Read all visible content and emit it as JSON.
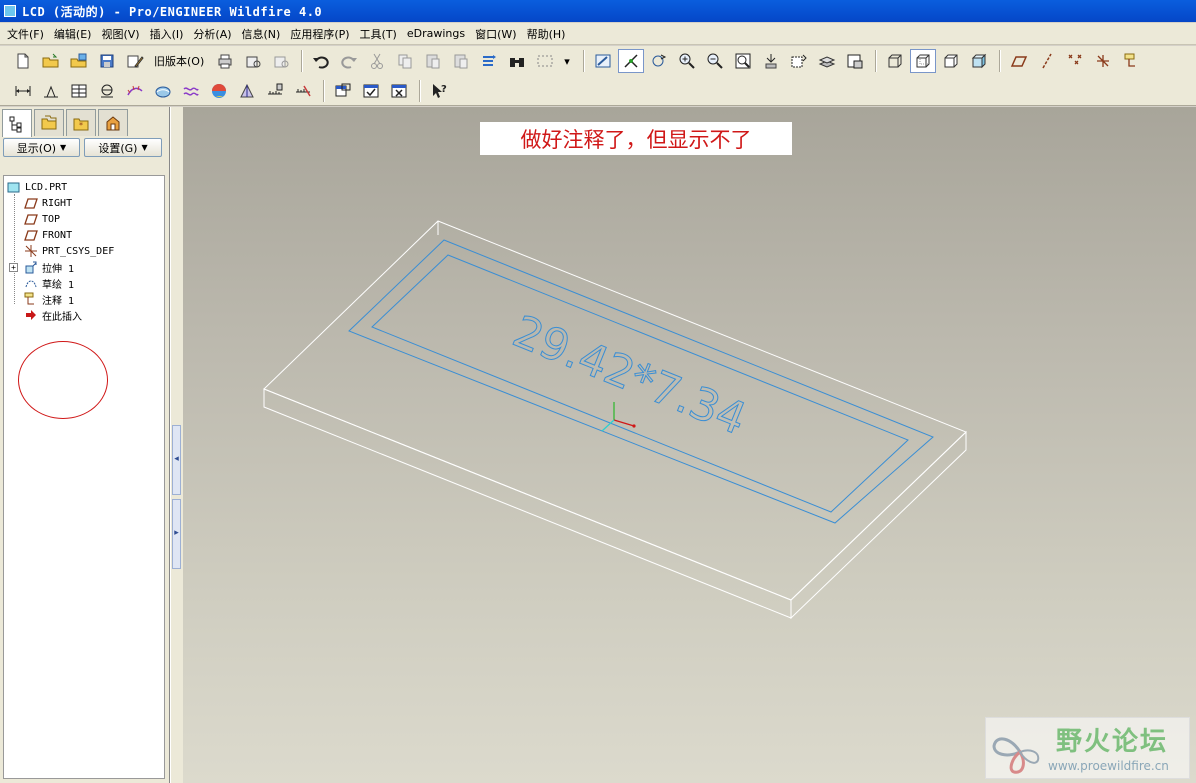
{
  "window": {
    "title": "LCD (活动的) - Pro/ENGINEER Wildfire 4.0"
  },
  "menu": [
    "文件(F)",
    "编辑(E)",
    "视图(V)",
    "插入(I)",
    "分析(A)",
    "信息(N)",
    "应用程序(P)",
    "工具(T)",
    "eDrawings",
    "窗口(W)",
    "帮助(H)"
  ],
  "toolbar": {
    "old_version_label": "旧版本(O)"
  },
  "panel": {
    "show_label": "显示(O)",
    "settings_label": "设置(G)",
    "tree": [
      {
        "label": "LCD.PRT",
        "icon": "part-icon"
      },
      {
        "label": "RIGHT",
        "icon": "datum-plane-icon"
      },
      {
        "label": "TOP",
        "icon": "datum-plane-icon"
      },
      {
        "label": "FRONT",
        "icon": "datum-plane-icon"
      },
      {
        "label": "PRT_CSYS_DEF",
        "icon": "coordinate-system-icon"
      },
      {
        "label": "拉伸 1",
        "icon": "extrude-icon"
      },
      {
        "label": "草绘 1",
        "icon": "sketch-icon"
      },
      {
        "label": "注释 1",
        "icon": "note-icon"
      },
      {
        "label": "在此插入",
        "icon": "insert-here-arrow-icon"
      }
    ]
  },
  "viewport": {
    "note_text": "做好注释了，但显示不了",
    "model_text": "29.42*7.34"
  },
  "watermark": {
    "title": "野火论坛",
    "url": "www.proewildfire.cn"
  },
  "colors": {
    "annotation_red": "#d01818",
    "sketch_blue": "#3a8ed4",
    "titlebar_blue": "#0546c7"
  }
}
